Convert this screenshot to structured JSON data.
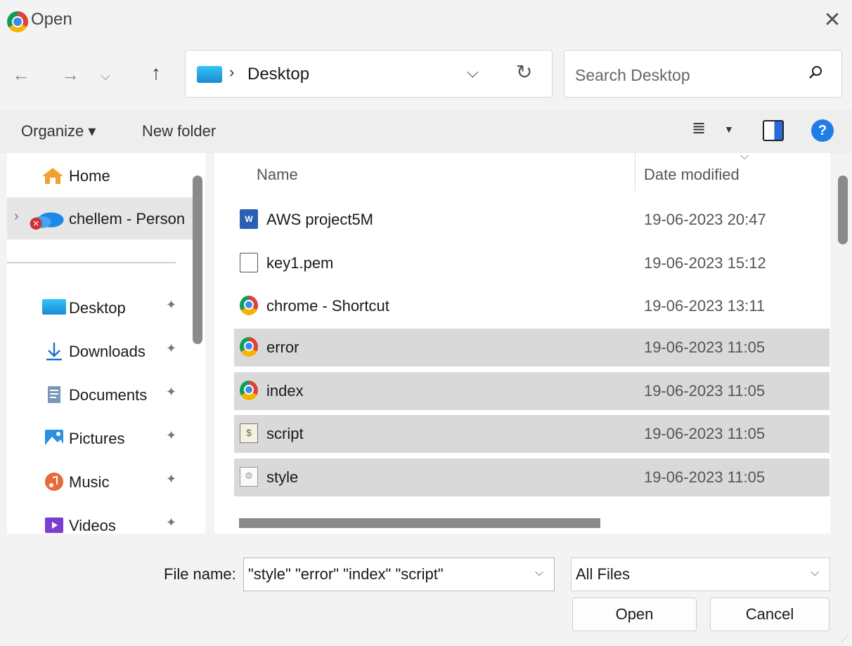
{
  "window": {
    "title": "Open",
    "close_glyph": "✕"
  },
  "nav": {
    "back_glyph": "←",
    "forward_glyph": "→",
    "recent_glyph": "⌵",
    "up_glyph": "↑",
    "address": {
      "separator": "›",
      "location": "Desktop",
      "dropdown_glyph": "⌵",
      "refresh_glyph": "↻"
    },
    "search": {
      "placeholder": "Search Desktop",
      "icon_glyph": "⚲"
    }
  },
  "toolbar": {
    "organize_label": "Organize ▾",
    "new_folder_label": "New folder",
    "view_glyph": "≣",
    "view_dropdown_glyph": "▼",
    "help_glyph": "?"
  },
  "sidebar": {
    "items": [
      {
        "label": "Home",
        "icon": "home-icon"
      },
      {
        "label": "chellem - Person",
        "icon": "onedrive-icon"
      },
      {
        "label": "Desktop",
        "icon": "desktop-folder-icon",
        "pinned": true
      },
      {
        "label": "Downloads",
        "icon": "download-icon",
        "pinned": true
      },
      {
        "label": "Documents",
        "icon": "documents-icon",
        "pinned": true
      },
      {
        "label": "Pictures",
        "icon": "pictures-icon",
        "pinned": true
      },
      {
        "label": "Music",
        "icon": "music-icon",
        "pinned": true
      },
      {
        "label": "Videos",
        "icon": "videos-icon",
        "pinned": true
      }
    ],
    "pin_glyph": "📌"
  },
  "filelist": {
    "columns": {
      "name": "Name",
      "date": "Date modified",
      "sort_glyph": "⌵"
    },
    "rows": [
      {
        "name": "AWS project5M",
        "date": "19-06-2023 20:47",
        "icon": "word-document-icon",
        "selected": false
      },
      {
        "name": "key1.pem",
        "date": "19-06-2023 15:12",
        "icon": "blank-file-icon",
        "selected": false
      },
      {
        "name": "chrome - Shortcut",
        "date": "19-06-2023 13:11",
        "icon": "chrome-shortcut-icon",
        "selected": false
      },
      {
        "name": "error",
        "date": "19-06-2023 11:05",
        "icon": "chrome-html-icon",
        "selected": true
      },
      {
        "name": "index",
        "date": "19-06-2023 11:05",
        "icon": "chrome-html-icon",
        "selected": true
      },
      {
        "name": "script",
        "date": "19-06-2023 11:05",
        "icon": "script-file-icon",
        "selected": true
      },
      {
        "name": "style",
        "date": "19-06-2023 11:05",
        "icon": "css-file-icon",
        "selected": true
      }
    ]
  },
  "footer": {
    "filename_label": "File name:",
    "filename_value": "\"style\" \"error\" \"index\" \"script\"",
    "filter_value": "All Files",
    "dropdown_glyph": "⌵",
    "open_label": "Open",
    "cancel_label": "Cancel"
  }
}
